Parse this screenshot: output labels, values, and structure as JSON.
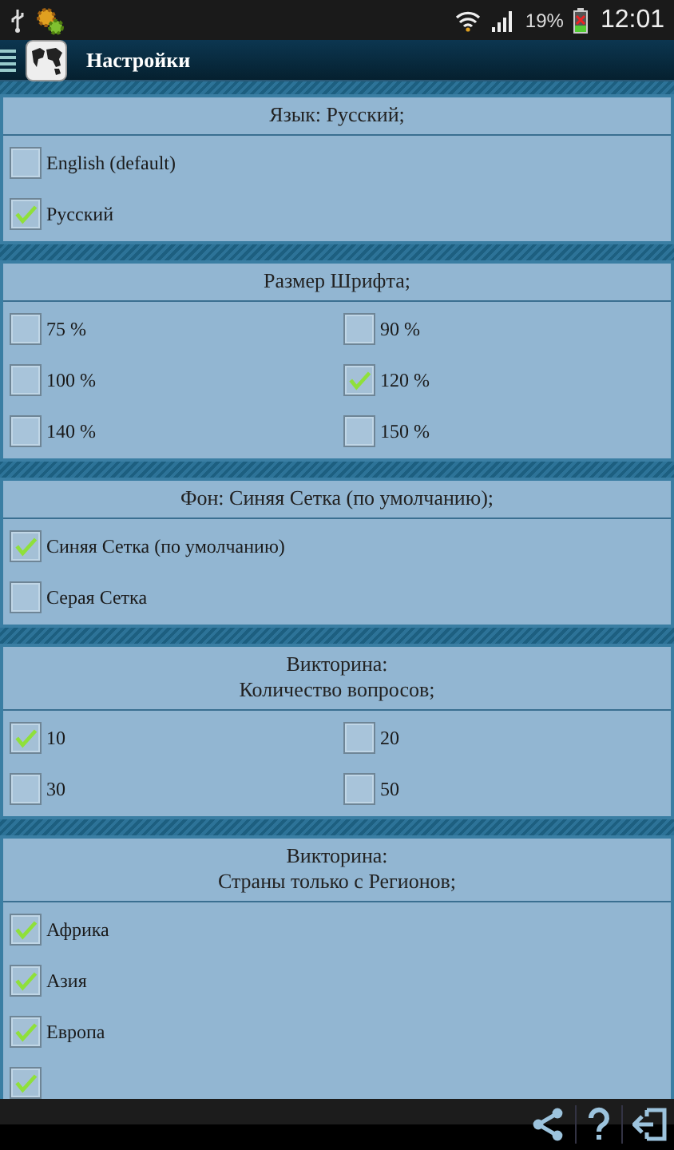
{
  "status_bar": {
    "battery": "19%",
    "time": "12:01"
  },
  "app_bar": {
    "title": "Настройки"
  },
  "sections": [
    {
      "title_lines": [
        "Язык: Русский;"
      ],
      "kind": "list",
      "options": [
        {
          "label": "English (default)",
          "checked": false
        },
        {
          "label": "Русский",
          "checked": true
        }
      ]
    },
    {
      "title_lines": [
        "Размер Шрифта;"
      ],
      "kind": "grid",
      "options": [
        {
          "label": "75 %",
          "checked": false
        },
        {
          "label": "90 %",
          "checked": false
        },
        {
          "label": "100 %",
          "checked": false
        },
        {
          "label": "120 %",
          "checked": true
        },
        {
          "label": "140 %",
          "checked": false
        },
        {
          "label": "150 %",
          "checked": false
        }
      ]
    },
    {
      "title_lines": [
        "Фон: Синяя Сетка (по умолчанию);"
      ],
      "kind": "list",
      "options": [
        {
          "label": "Синяя Сетка (по умолчанию)",
          "checked": true
        },
        {
          "label": "Серая Сетка",
          "checked": false
        }
      ]
    },
    {
      "title_lines": [
        "Викторина:",
        "Количество вопросов;"
      ],
      "kind": "grid",
      "options": [
        {
          "label": "10",
          "checked": true
        },
        {
          "label": "20",
          "checked": false
        },
        {
          "label": "30",
          "checked": false
        },
        {
          "label": "50",
          "checked": false
        }
      ]
    },
    {
      "title_lines": [
        "Викторина:",
        "Страны только с Регионов;"
      ],
      "kind": "list",
      "options": [
        {
          "label": "Африка",
          "checked": true
        },
        {
          "label": "Азия",
          "checked": true
        },
        {
          "label": "Европа",
          "checked": true
        },
        {
          "checked": true
        }
      ]
    }
  ]
}
